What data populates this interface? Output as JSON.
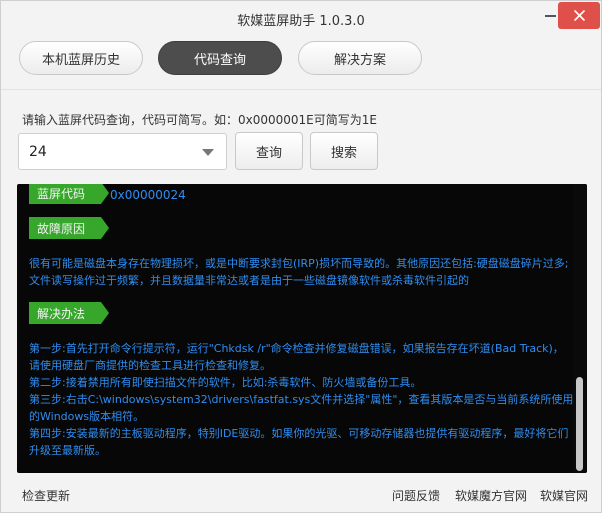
{
  "window": {
    "title": "软媒蓝屏助手 1.0.3.0"
  },
  "tabs": [
    {
      "label": "本机蓝屏历史",
      "active": false
    },
    {
      "label": "代码查询",
      "active": true
    },
    {
      "label": "解决方案",
      "active": false
    }
  ],
  "query": {
    "prompt": "请输入蓝屏代码查询，代码可简写。如：0x0000001E可简写为1E",
    "input_value": "24",
    "query_button": "查询",
    "search_button": "搜索"
  },
  "result": {
    "code_tag": "蓝屏代码",
    "code_value": "0x00000024",
    "cause_tag": "故障原因",
    "cause_text": "很有可能是磁盘本身存在物理损坏，或是中断要求封包(IRP)损坏而导致的。其他原因还包括:硬盘磁盘碎片过多; 文件读写操作过于频繁，并且数据量非常达或者是由于一些磁盘镜像软件或杀毒软件引起的",
    "solution_tag": "解决办法",
    "solution_lines": [
      "第一步:首先打开命令行提示符，运行\"Chkdsk /r\"命令检查并修复磁盘错误，如果报告存在坏道(Bad Track)，请使用硬盘厂商提供的检查工具进行检查和修复。",
      "第二步:接着禁用所有即使扫描文件的软件，比如:杀毒软件、防火墙或备份工具。",
      "第三步:右击C:\\windows\\system32\\drivers\\fastfat.sys文件并选择\"属性\"，查看其版本是否与当前系统所使用的Windows版本相符。",
      "第四步:安装最新的主板驱动程序，特别IDE驱动。如果你的光驱、可移动存储器也提供有驱动程序，最好将它们升级至最新版。"
    ]
  },
  "footer": {
    "check_update": "检查更新",
    "feedback": "问题反馈",
    "mofang_site": "软媒魔方官网",
    "official_site": "软媒官网"
  },
  "colors": {
    "tag_green": "#37a72c",
    "text_blue": "#2f8df0",
    "close_red": "#e0504a",
    "active_tab": "#4d4d4d"
  }
}
